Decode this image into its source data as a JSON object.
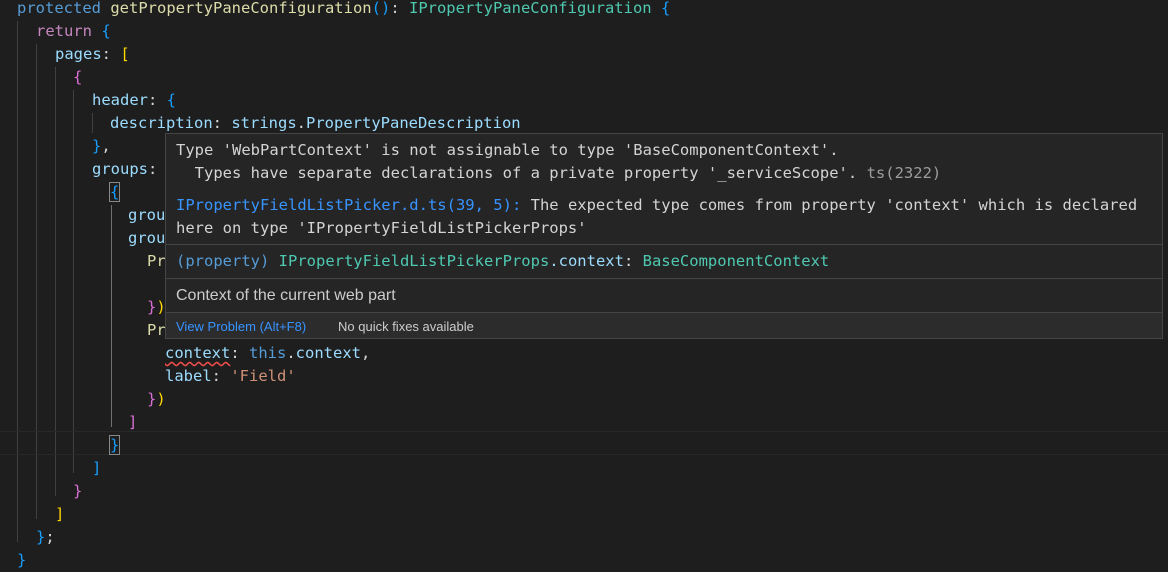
{
  "code": {
    "protected_kw": "protected",
    "method_name": "getPropertyPaneConfiguration",
    "return_type": "IPropertyPaneConfiguration",
    "return_kw": "return",
    "pages_prop": "pages",
    "header_prop": "header",
    "description_prop": "description",
    "strings_obj": "strings",
    "description_value": "PropertyPaneDescription",
    "groups_prop": "groups",
    "partial_group_1": "grou",
    "partial_group_2": "grou",
    "partial_pr_1": "Pr",
    "partial_pr_2": "Pr",
    "context_prop": "context",
    "this_kw": "this",
    "context_member": "context",
    "label_prop": "label",
    "label_value": "'Field'"
  },
  "hover": {
    "error_line_1": "Type 'WebPartContext' is not assignable to type 'BaseComponentContext'.",
    "error_line_2": "  Types have separate declarations of a private property '_serviceScope'.",
    "error_code": "ts(2322)",
    "related_file": "IPropertyFieldListPicker.d.ts(39, 5):",
    "related_msg_1": " The expected type comes from property 'context' which is declared",
    "related_msg_2": "here on type 'IPropertyFieldListPickerProps'",
    "signature_prefix": "(property) ",
    "signature_type": "IPropertyFieldListPickerProps",
    "signature_member": ".context",
    "signature_colon": ": ",
    "signature_return": "BaseComponentContext",
    "doc": "Context of the current web part",
    "view_problem": "View Problem (Alt+F8)",
    "no_quick_fixes": "No quick fixes available"
  },
  "colors": {
    "background": "#1e1e1e",
    "keyword": "#569cd6",
    "control": "#c586c0",
    "function": "#dcdcaa",
    "type": "#4ec9b0",
    "variable": "#9cdcfe",
    "string": "#ce9178",
    "link": "#3794ff",
    "error_squiggle": "#f14c4c"
  }
}
